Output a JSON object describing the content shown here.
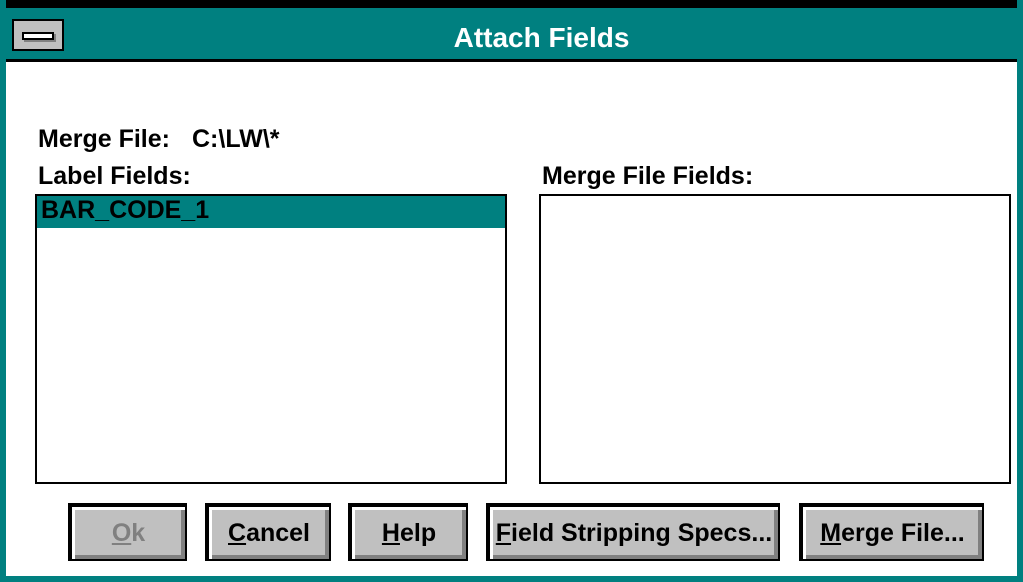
{
  "window": {
    "title": "Attach Fields",
    "sysmenu_icon": "system-menu-icon",
    "accent_color": "#008080"
  },
  "merge_file": {
    "label": "Merge File:",
    "value": "C:\\LW\\*"
  },
  "label_fields": {
    "label": "Label Fields:",
    "items": [
      {
        "text": "BAR_CODE_1",
        "selected": true
      }
    ]
  },
  "merge_file_fields": {
    "label": "Merge File Fields:",
    "items": []
  },
  "buttons": {
    "ok": {
      "mnemonic": "O",
      "rest": "k",
      "enabled": false
    },
    "cancel": {
      "mnemonic": "C",
      "rest": "ancel",
      "enabled": true
    },
    "help": {
      "mnemonic": "H",
      "rest": "elp",
      "enabled": true
    },
    "field_stripping": {
      "mnemonic": "F",
      "rest": "ield Stripping Specs...",
      "enabled": true
    },
    "merge_file": {
      "mnemonic": "M",
      "rest": "erge File...",
      "enabled": true
    }
  }
}
